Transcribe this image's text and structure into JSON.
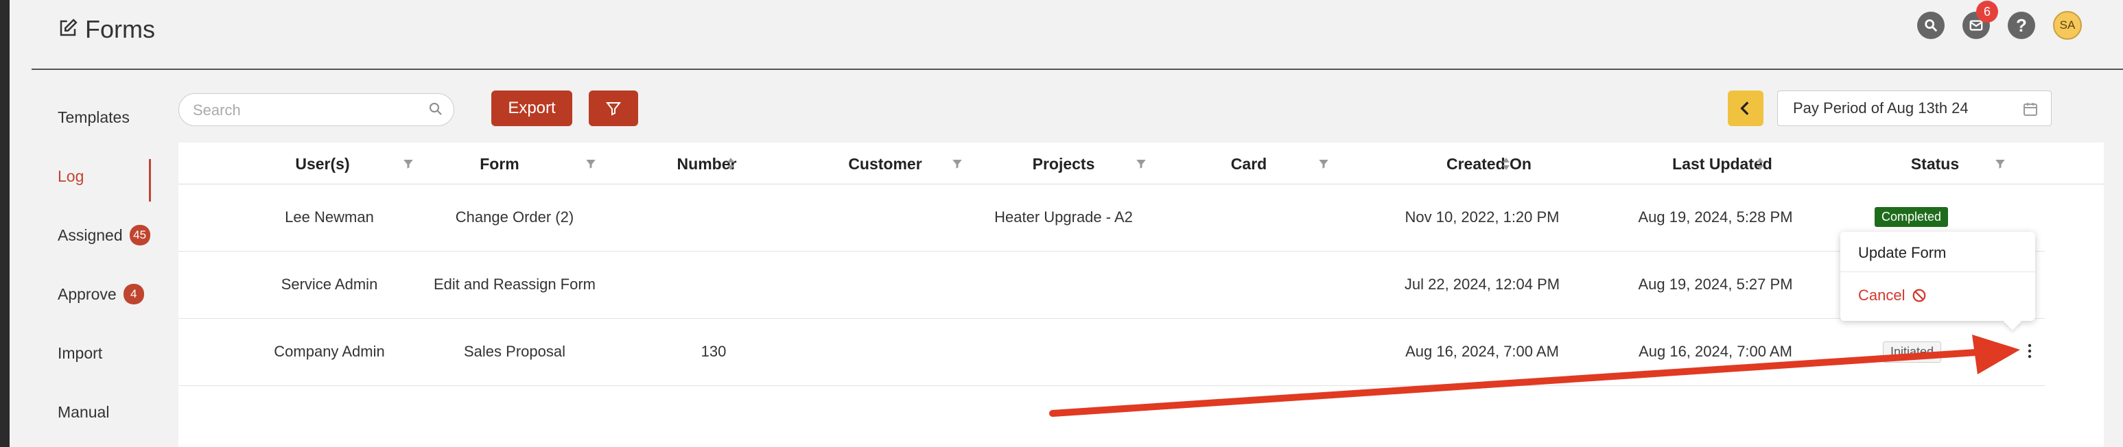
{
  "app": {
    "title": "Forms"
  },
  "header": {
    "notification_count": "6",
    "avatar_initials": "SA"
  },
  "sidebar": {
    "items": [
      {
        "label": "Templates",
        "badge": ""
      },
      {
        "label": "Log",
        "badge": ""
      },
      {
        "label": "Assigned",
        "badge": "45"
      },
      {
        "label": "Approve",
        "badge": "4"
      },
      {
        "label": "Import",
        "badge": ""
      },
      {
        "label": "Manual",
        "badge": ""
      }
    ],
    "active": "Log"
  },
  "toolbar": {
    "search_placeholder": "Search",
    "export_label": "Export",
    "pay_period": "Pay Period of Aug 13th 24"
  },
  "table": {
    "columns": [
      "User(s)",
      "Form",
      "Number",
      "Customer",
      "Projects",
      "Card",
      "Created On",
      "Last Updated",
      "Status"
    ],
    "rows": [
      {
        "user": "Lee Newman",
        "form": "Change Order (2)",
        "number": "",
        "customer": "",
        "project": "Heater Upgrade - A2",
        "card": "",
        "created": "Nov 10, 2022, 1:20 PM",
        "updated": "Aug 19, 2024, 5:28 PM",
        "status": "Completed"
      },
      {
        "user": "Service Admin",
        "form": "Edit and Reassign Form",
        "number": "",
        "customer": "",
        "project": "",
        "card": "",
        "created": "Jul 22, 2024, 12:04 PM",
        "updated": "Aug 19, 2024, 5:27 PM",
        "status": ""
      },
      {
        "user": "Company Admin",
        "form": "Sales Proposal",
        "number": "130",
        "customer": "",
        "project": "",
        "card": "",
        "created": "Aug 16, 2024, 7:00 AM",
        "updated": "Aug 16, 2024, 7:00 AM",
        "status": "Initiated"
      }
    ]
  },
  "context_menu": {
    "update_label": "Update Form",
    "cancel_label": "Cancel"
  },
  "colors": {
    "accent_red": "#b93b23",
    "back_button": "#f0c240",
    "status_completed": "#1f6b1c",
    "annotation_arrow": "#e03a22"
  }
}
